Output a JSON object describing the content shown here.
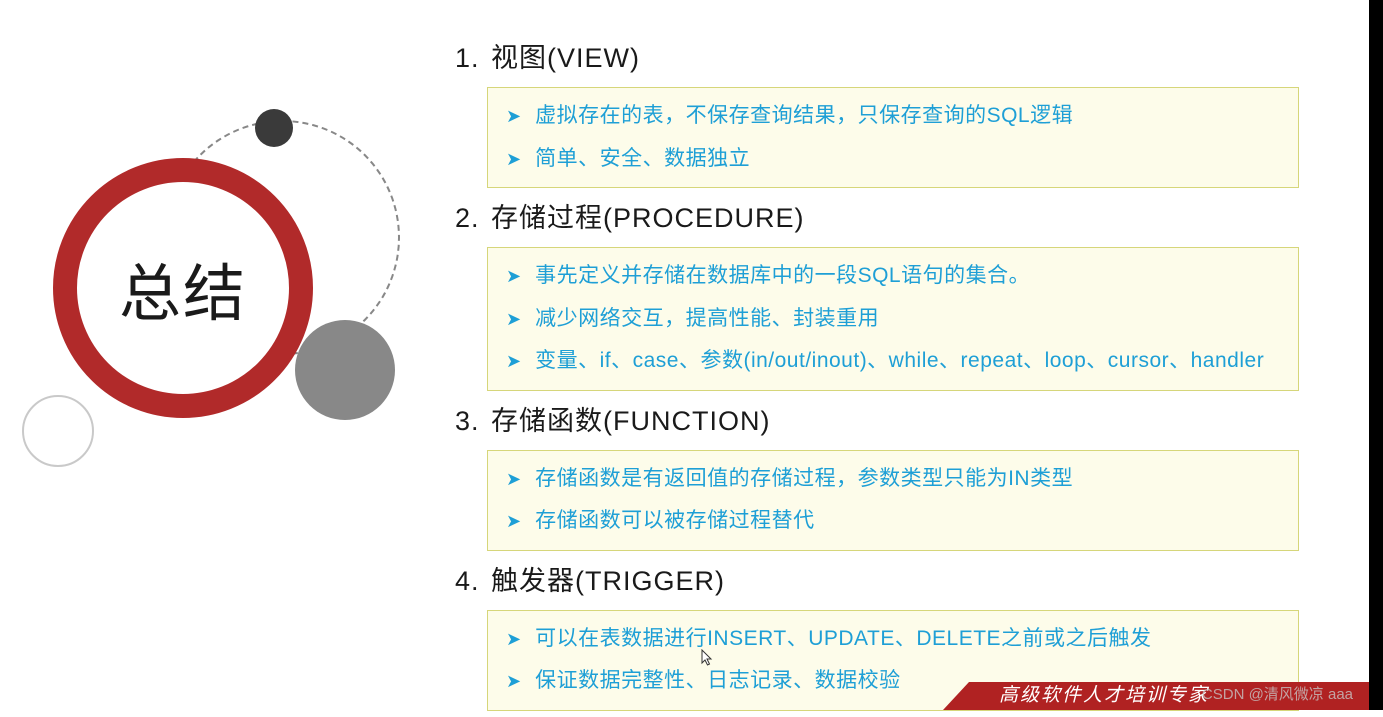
{
  "summary_title": "总结",
  "sections": [
    {
      "num": "1.",
      "title": "视图(VIEW)",
      "bullets": [
        "虚拟存在的表，不保存查询结果，只保存查询的SQL逻辑",
        "简单、安全、数据独立"
      ]
    },
    {
      "num": "2.",
      "title": "存储过程(PROCEDURE)",
      "bullets": [
        "事先定义并存储在数据库中的一段SQL语句的集合。",
        "减少网络交互，提高性能、封装重用",
        "变量、if、case、参数(in/out/inout)、while、repeat、loop、cursor、handler"
      ]
    },
    {
      "num": "3.",
      "title": "存储函数(FUNCTION)",
      "bullets": [
        "存储函数是有返回值的存储过程，参数类型只能为IN类型",
        "存储函数可以被存储过程替代"
      ]
    },
    {
      "num": "4.",
      "title": "触发器(TRIGGER)",
      "bullets": [
        "可以在表数据进行INSERT、UPDATE、DELETE之前或之后触发",
        "保证数据完整性、日志记录、数据校验"
      ]
    }
  ],
  "banner_text": "高级软件人才培训专家",
  "watermark": "CSDN @清风微凉 aaa"
}
